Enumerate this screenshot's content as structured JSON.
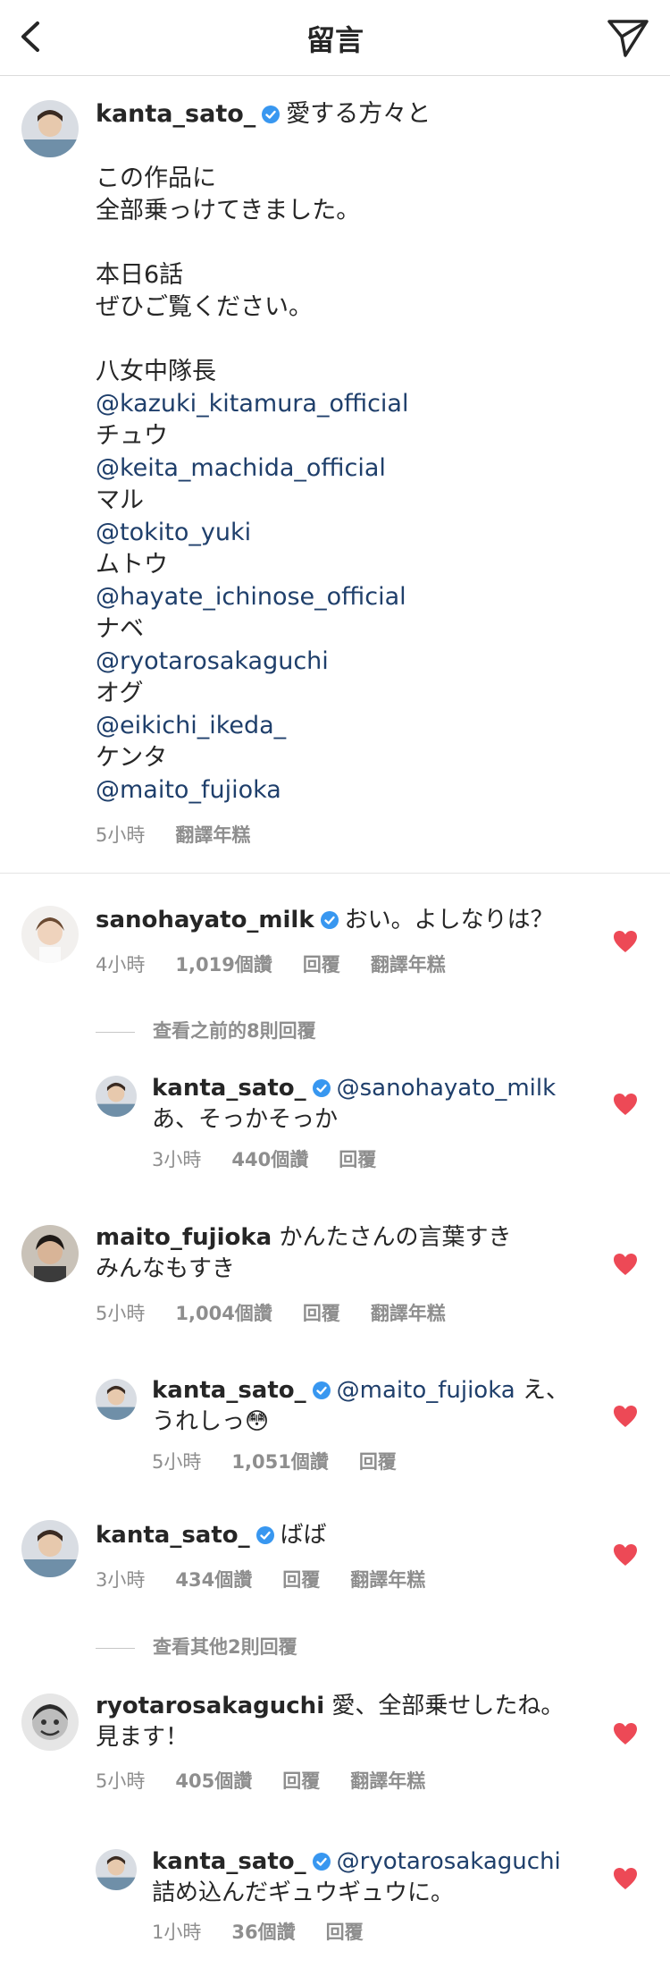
{
  "header": {
    "title": "留言"
  },
  "caption": {
    "username": "kanta_sato_",
    "lines": [
      "愛する方々と",
      "",
      "この作品に",
      "全部乗っけてきました。",
      "",
      "本日6話",
      "ぜひご覧ください。",
      "",
      "八女中隊長",
      "@kazuki_kitamura_official",
      "チュウ",
      "@keita_machida_official",
      "マル",
      "@tokito_yuki",
      "ムトウ",
      "@hayate_ichinose_official",
      "ナベ",
      "@ryotarosakaguchi",
      "オグ",
      "@eikichi_ikeda_",
      "ケンタ",
      "@maito_fujioka"
    ],
    "time": "5小時",
    "translate": "翻譯年糕"
  },
  "comments": [
    {
      "username": "sanohayato_milk",
      "text1": "おい。よしなりは？",
      "text2": "",
      "time": "4小時",
      "likes": "1,019個讚",
      "reply": "回覆",
      "translate": "翻譯年糕"
    },
    {
      "username": "kanta_sato_",
      "mention": "@sanohayato_milk",
      "text1": "",
      "text2": "あ、そっかそっか",
      "time": "3小時",
      "likes": "440個讚",
      "reply": "回覆"
    },
    {
      "username": "maito_fujioka",
      "text1": "かんたさんの言葉すき",
      "text2": "みんなもすき",
      "time": "5小時",
      "likes": "1,004個讚",
      "reply": "回覆",
      "translate": "翻譯年糕"
    },
    {
      "username": "kanta_sato_",
      "mention": "@maito_fujioka",
      "text1": " え、",
      "text2": "うれしっ😳",
      "time": "5小時",
      "likes": "1,051個讚",
      "reply": "回覆"
    },
    {
      "username": "kanta_sato_",
      "text1": "ばば",
      "text2": "",
      "time": "3小時",
      "likes": "434個讚",
      "reply": "回覆",
      "translate": "翻譯年糕"
    },
    {
      "username": "ryotarosakaguchi",
      "text1": " 愛、全部乗せしたね。",
      "text2": "見ます！",
      "time": "5小時",
      "likes": "405個讚",
      "reply": "回覆",
      "translate": "翻譯年糕"
    },
    {
      "username": "kanta_sato_",
      "mention": "@ryotarosakaguchi",
      "text1": "",
      "text2": "詰め込んだギュウギュウに。",
      "time": "1小時",
      "likes": "36個讚",
      "reply": "回覆"
    }
  ],
  "view_more": [
    "查看之前的8則回覆",
    "查看其他2則回覆"
  ],
  "colors": {
    "heart": "#ed4956",
    "verified": "#3897f0",
    "mention": "#1f3f6b",
    "meta": "#8e8e8e"
  }
}
